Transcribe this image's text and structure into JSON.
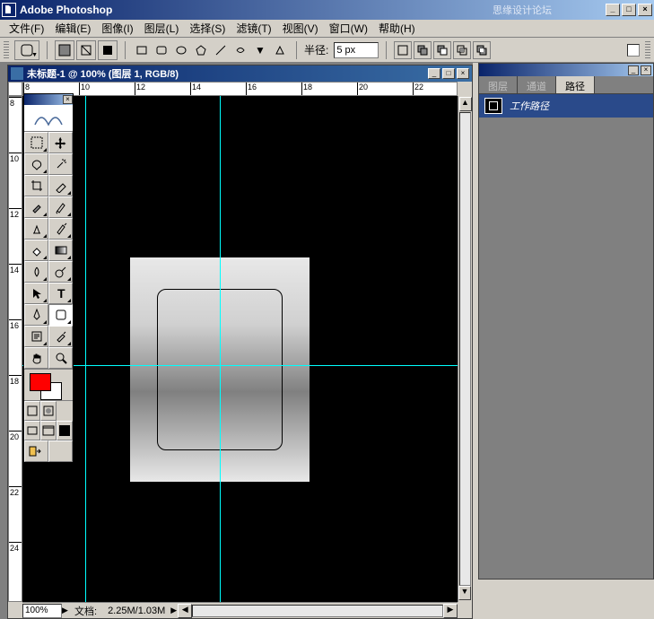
{
  "app": {
    "title": "Adobe Photoshop",
    "watermark": "思缘设计论坛"
  },
  "window_controls": {
    "min": "_",
    "max": "□",
    "close": "×"
  },
  "menu": {
    "file": "文件(F)",
    "edit": "编辑(E)",
    "image": "图像(I)",
    "layer": "图层(L)",
    "select": "选择(S)",
    "filter": "滤镜(T)",
    "view": "视图(V)",
    "window": "窗口(W)",
    "help": "帮助(H)"
  },
  "options": {
    "radius_label": "半径:",
    "radius_value": "5 px"
  },
  "document": {
    "title": "未标题-1 @ 100% (图层 1, RGB/8)",
    "zoom": "100%",
    "status_label": "文档:",
    "status_value": "2.25M/1.03M"
  },
  "rulers": {
    "h": [
      "8",
      "10",
      "12",
      "14",
      "16",
      "18",
      "20",
      "22"
    ],
    "v": [
      "8",
      "10",
      "12",
      "14",
      "16",
      "18",
      "20",
      "22",
      "24"
    ]
  },
  "toolbox": {
    "fg_color": "#ff0000",
    "bg_color": "#ffffff"
  },
  "panels": {
    "tabs": {
      "layers": "图层",
      "channels": "通道",
      "paths": "路径"
    },
    "active_tab": "paths",
    "path_item": "工作路径"
  }
}
